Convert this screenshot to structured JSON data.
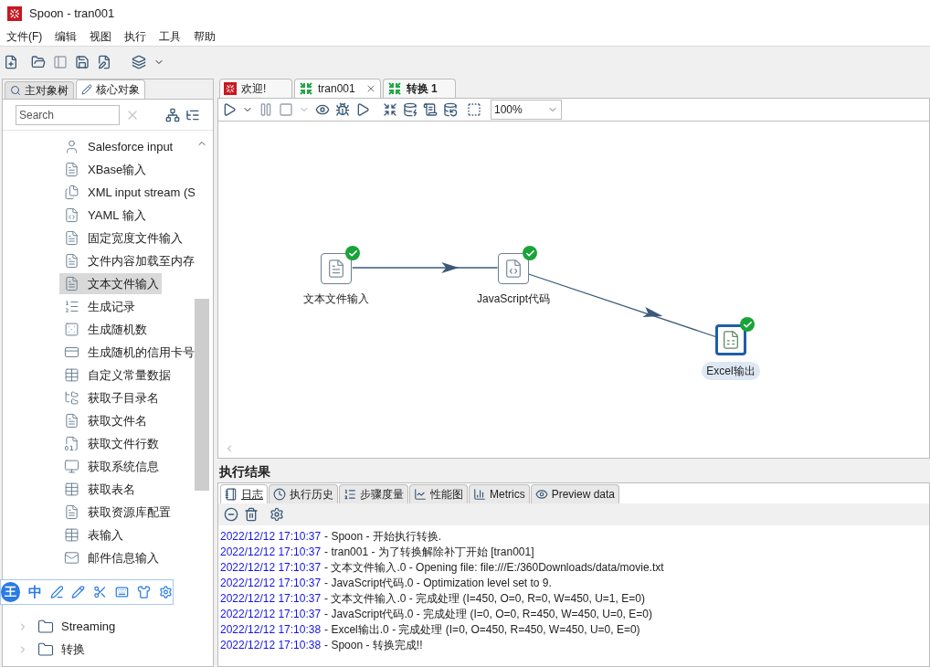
{
  "window": {
    "title": "Spoon - tran001"
  },
  "menu": [
    "文件(F)",
    "编辑",
    "视图",
    "执行",
    "工具",
    "帮助"
  ],
  "left_tabs": [
    {
      "label": "主对象树",
      "selected": false
    },
    {
      "label": "核心对象",
      "selected": true
    }
  ],
  "search": {
    "placeholder": "Search"
  },
  "tree": [
    {
      "label": "Salesforce input",
      "kind": "step",
      "selected": false
    },
    {
      "label": "XBase输入",
      "kind": "step",
      "selected": false
    },
    {
      "label": "XML input stream (S",
      "kind": "step",
      "selected": false
    },
    {
      "label": "YAML 输入",
      "kind": "step",
      "selected": false
    },
    {
      "label": "固定宽度文件输入",
      "kind": "step",
      "selected": false
    },
    {
      "label": "文件内容加载至内存",
      "kind": "step",
      "selected": false
    },
    {
      "label": "文本文件输入",
      "kind": "step",
      "selected": true
    },
    {
      "label": "生成记录",
      "kind": "step",
      "selected": false
    },
    {
      "label": "生成随机数",
      "kind": "step",
      "selected": false
    },
    {
      "label": "生成随机的信用卡号",
      "kind": "step",
      "selected": false
    },
    {
      "label": "自定义常量数据",
      "kind": "step",
      "selected": false
    },
    {
      "label": "获取子目录名",
      "kind": "step",
      "selected": false
    },
    {
      "label": "获取文件名",
      "kind": "step",
      "selected": false
    },
    {
      "label": "获取文件行数",
      "kind": "step",
      "selected": false
    },
    {
      "label": "获取系统信息",
      "kind": "step",
      "selected": false
    },
    {
      "label": "获取表名",
      "kind": "step",
      "selected": false
    },
    {
      "label": "获取资源库配置",
      "kind": "step",
      "selected": false
    },
    {
      "label": "表输入",
      "kind": "step",
      "selected": false
    },
    {
      "label": "邮件信息输入",
      "kind": "step",
      "selected": false
    },
    {
      "label": "Streaming",
      "kind": "folder",
      "expanded": false
    },
    {
      "label": "转换",
      "kind": "folder",
      "expanded": false
    }
  ],
  "editor_tabs": [
    {
      "label": "欢迎!",
      "kind": "welcome",
      "selected": false,
      "closable": false
    },
    {
      "label": "tran001",
      "kind": "transformation",
      "selected": true,
      "closable": true
    },
    {
      "label": "转换 1",
      "kind": "transformation",
      "selected": false,
      "closable": false
    }
  ],
  "zoom": {
    "value": "100%"
  },
  "steps": [
    {
      "label": "文本文件输入",
      "kind": "text_input",
      "selected": false,
      "ok": true
    },
    {
      "label": "JavaScript代码",
      "kind": "javascript",
      "selected": false,
      "ok": true
    },
    {
      "label": "Excel输出",
      "kind": "excel_output",
      "selected": true,
      "ok": true
    }
  ],
  "results": {
    "title": "执行结果",
    "tabs": [
      {
        "label": "日志",
        "selected": true
      },
      {
        "label": "执行历史",
        "selected": false
      },
      {
        "label": "步骤度量",
        "selected": false
      },
      {
        "label": "性能图",
        "selected": false
      },
      {
        "label": "Metrics",
        "selected": false
      },
      {
        "label": "Preview data",
        "selected": false
      }
    ],
    "log": [
      {
        "time": "2022/12/12 17:10:37",
        "message": "- Spoon - 开始执行转换."
      },
      {
        "time": "2022/12/12 17:10:37",
        "message": "- tran001 - 为了转换解除补丁开始  [tran001]"
      },
      {
        "time": "2022/12/12 17:10:37",
        "message": "- 文本文件输入.0 - Opening file: file:///E:/360Downloads/data/movie.txt"
      },
      {
        "time": "2022/12/12 17:10:37",
        "message": "- JavaScript代码.0 - Optimization level set to 9."
      },
      {
        "time": "2022/12/12 17:10:37",
        "message": "- 文本文件输入.0 - 完成处理 (I=450, O=0, R=0, W=450, U=1, E=0)"
      },
      {
        "time": "2022/12/12 17:10:37",
        "message": "- JavaScript代码.0 - 完成处理 (I=0, O=0, R=450, W=450, U=0, E=0)"
      },
      {
        "time": "2022/12/12 17:10:38",
        "message": "- Excel输出.0 - 完成处理 (I=0, O=450, R=450, W=450, U=0, E=0)"
      },
      {
        "time": "2022/12/12 17:10:38",
        "message": "- Spoon - 转换完成!!"
      }
    ]
  },
  "ime": {
    "logo": "王",
    "mode": "中"
  }
}
